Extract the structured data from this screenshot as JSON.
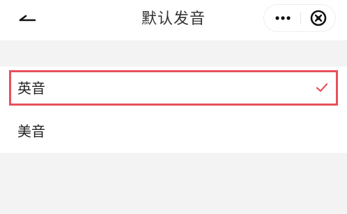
{
  "header": {
    "title": "默认发音",
    "back_icon": "back-arrow-icon",
    "more_icon": "more-dots-icon",
    "close_icon": "close-circle-icon"
  },
  "options": [
    {
      "label": "英音",
      "selected": true
    },
    {
      "label": "美音",
      "selected": false
    }
  ],
  "colors": {
    "background": "#f3f3f3",
    "surface": "#ffffff",
    "check": "#e8505b",
    "highlight": "#e8505b"
  }
}
